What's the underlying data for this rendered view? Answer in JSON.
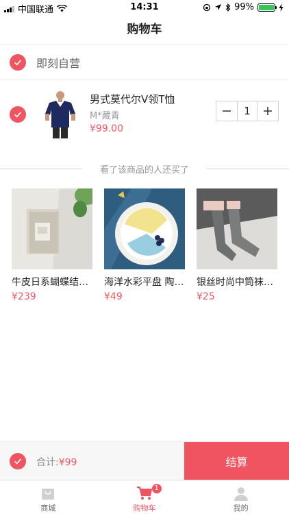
{
  "status_bar": {
    "carrier": "中国联通",
    "time": "14:31",
    "battery_percent": "99%",
    "battery_level": 0.99,
    "battery_color": "#35c759"
  },
  "nav": {
    "title": "购物车"
  },
  "shop": {
    "name": "即刻自营",
    "checked": true
  },
  "cart_item": {
    "name": "男式莫代尔V领T恤",
    "spec": "M*藏青",
    "price": "¥99.00",
    "quantity": "1",
    "checked": true,
    "image_icon": "navy-tshirt-model-image"
  },
  "recommend": {
    "title": "看了该商品的人还买了",
    "products": [
      {
        "name": "牛皮日系蝴蝶结女款短款钱包",
        "price": "¥239",
        "image_icon": "leather-wallet-image"
      },
      {
        "name": "海洋水彩平盘 陶瓷餐盘",
        "price": "¥49",
        "image_icon": "watercolor-plate-image"
      },
      {
        "name": "银丝时尚中筒袜女款",
        "price": "¥25",
        "image_icon": "grey-socks-image"
      }
    ]
  },
  "checkout": {
    "total_label": "合计:",
    "total_amount": "¥99",
    "pay_label": "结算",
    "all_checked": true
  },
  "tabs": [
    {
      "label": "商城",
      "icon": "shop-bag-icon",
      "active": false
    },
    {
      "label": "购物车",
      "icon": "cart-icon",
      "active": true,
      "badge": "1"
    },
    {
      "label": "我的",
      "icon": "user-icon",
      "active": false
    }
  ],
  "colors": {
    "accent": "#ef5461",
    "pay_button": "#f05460"
  }
}
